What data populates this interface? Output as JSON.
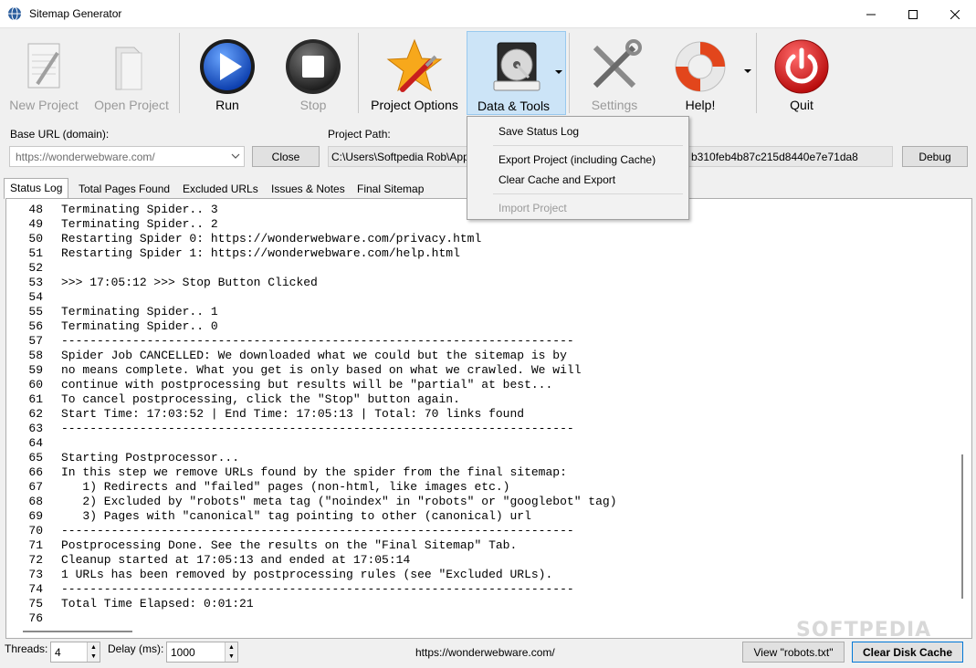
{
  "window": {
    "title": "Sitemap Generator"
  },
  "toolbar": {
    "new_project": "New Project",
    "open_project": "Open Project",
    "run": "Run",
    "stop": "Stop",
    "project_options": "Project Options",
    "data_tools": "Data & Tools",
    "settings": "Settings",
    "help": "Help!",
    "quit": "Quit"
  },
  "form": {
    "base_url_label": "Base URL (domain):",
    "base_url_value": "https://wonderwebware.com/",
    "close_button": "Close",
    "project_path_label": "Project Path:",
    "project_path_value": "C:\\Users\\Softpedia Rob\\App",
    "project_path_tail": "b310feb4b87c215d8440e7e71da8",
    "debug_button": "Debug"
  },
  "tabs": [
    {
      "label": "Status Log"
    },
    {
      "label": "Total Pages Found"
    },
    {
      "label": "Excluded URLs"
    },
    {
      "label": "Issues & Notes"
    },
    {
      "label": "Final Sitemap"
    }
  ],
  "menu": {
    "save_status_log": "Save Status Log",
    "export_project": "Export Project (including Cache)",
    "clear_cache_export": "Clear Cache and Export",
    "import_project": "Import Project"
  },
  "log": [
    {
      "n": "48",
      "t": "Terminating Spider.. 3"
    },
    {
      "n": "49",
      "t": "Terminating Spider.. 2"
    },
    {
      "n": "50",
      "t": "Restarting Spider 0: https://wonderwebware.com/privacy.html"
    },
    {
      "n": "51",
      "t": "Restarting Spider 1: https://wonderwebware.com/help.html"
    },
    {
      "n": "52",
      "t": ""
    },
    {
      "n": "53",
      "t": ">>> 17:05:12 >>> Stop Button Clicked"
    },
    {
      "n": "54",
      "t": ""
    },
    {
      "n": "55",
      "t": "Terminating Spider.. 1"
    },
    {
      "n": "56",
      "t": "Terminating Spider.. 0"
    },
    {
      "n": "57",
      "t": "------------------------------------------------------------------------"
    },
    {
      "n": "58",
      "t": "Spider Job CANCELLED: We downloaded what we could but the sitemap is by"
    },
    {
      "n": "59",
      "t": "no means complete. What you get is only based on what we crawled. We will"
    },
    {
      "n": "60",
      "t": "continue with postprocessing but results will be \"partial\" at best..."
    },
    {
      "n": "61",
      "t": "To cancel postprocessing, click the \"Stop\" button again."
    },
    {
      "n": "62",
      "t": "Start Time: 17:03:52 | End Time: 17:05:13 | Total: 70 links found"
    },
    {
      "n": "63",
      "t": "------------------------------------------------------------------------"
    },
    {
      "n": "64",
      "t": ""
    },
    {
      "n": "65",
      "t": "Starting Postprocessor..."
    },
    {
      "n": "66",
      "t": "In this step we remove URLs found by the spider from the final sitemap:"
    },
    {
      "n": "67",
      "t": "   1) Redirects and \"failed\" pages (non-html, like images etc.)"
    },
    {
      "n": "68",
      "t": "   2) Excluded by \"robots\" meta tag (\"noindex\" in \"robots\" or \"googlebot\" tag)"
    },
    {
      "n": "69",
      "t": "   3) Pages with \"canonical\" tag pointing to other (canonical) url"
    },
    {
      "n": "70",
      "t": "------------------------------------------------------------------------"
    },
    {
      "n": "71",
      "t": "Postprocessing Done. See the results on the \"Final Sitemap\" Tab."
    },
    {
      "n": "72",
      "t": "Cleanup started at 17:05:13 and ended at 17:05:14"
    },
    {
      "n": "73",
      "t": "1 URLs has been removed by postprocessing rules (see \"Excluded URLs)."
    },
    {
      "n": "74",
      "t": "------------------------------------------------------------------------"
    },
    {
      "n": "75",
      "t": "Total Time Elapsed: 0:01:21"
    },
    {
      "n": "76",
      "t": ""
    }
  ],
  "status": {
    "threads_label": "Threads:",
    "threads_value": "4",
    "delay_label": "Delay (ms):",
    "delay_value": "1000",
    "current_url": "https://wonderwebware.com/",
    "view_robots": "View \"robots.txt\"",
    "clear_disk_cache": "Clear Disk Cache"
  },
  "watermark": "SOFTPEDIA",
  "colors": {
    "active_highlight": "#cce4f7",
    "run_blue": "#1e5fd6",
    "quit_red": "#d81e1e"
  }
}
